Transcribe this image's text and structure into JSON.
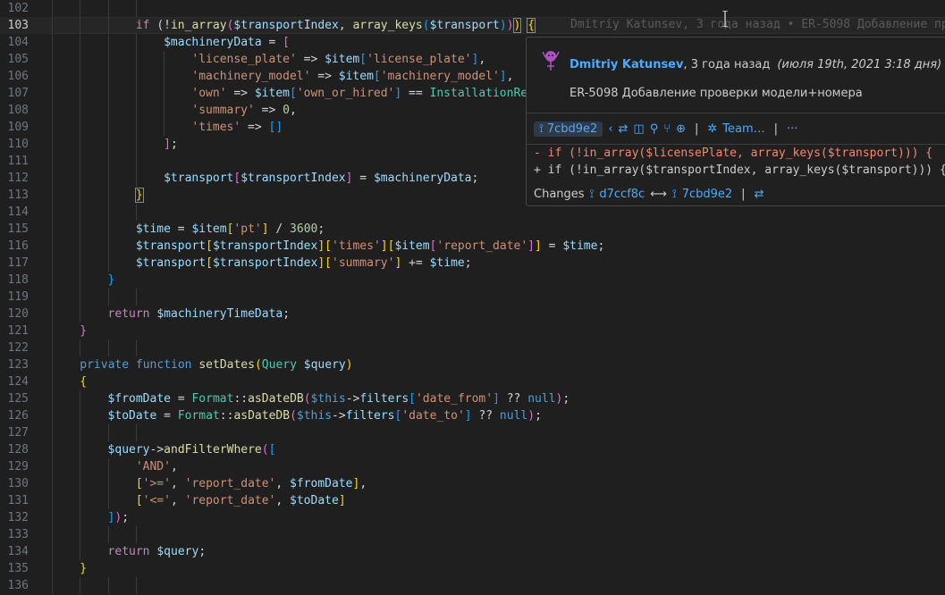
{
  "editor": {
    "lines": [
      {
        "n": "102",
        "segs": []
      },
      {
        "n": "103",
        "current": true,
        "segs": [
          [
            "kw",
            "if "
          ],
          [
            "op",
            "("
          ],
          [
            "op",
            "!"
          ],
          [
            "fn",
            "in_array"
          ],
          [
            "b2",
            "("
          ],
          [
            "var",
            "$transportIndex"
          ],
          [
            "op",
            ", "
          ],
          [
            "fn",
            "array_keys"
          ],
          [
            "b3",
            "("
          ],
          [
            "var",
            "$transport"
          ],
          [
            "b3",
            ")"
          ],
          [
            "b2",
            ")"
          ],
          [
            "b1bm",
            ")"
          ],
          [
            "op",
            " "
          ],
          [
            "b1bm",
            "{"
          ]
        ]
      },
      {
        "n": "104",
        "segs": [
          [
            "var",
            "$machineryData"
          ],
          [
            "op",
            " = "
          ],
          [
            "b2",
            "["
          ]
        ]
      },
      {
        "n": "105",
        "segs": [
          [
            "str",
            "'license_plate'"
          ],
          [
            "op",
            " => "
          ],
          [
            "var",
            "$item"
          ],
          [
            "b3",
            "["
          ],
          [
            "str",
            "'license_plate'"
          ],
          [
            "b3",
            "]"
          ],
          [
            "op",
            ","
          ]
        ]
      },
      {
        "n": "106",
        "segs": [
          [
            "str",
            "'machinery_model'"
          ],
          [
            "op",
            " => "
          ],
          [
            "var",
            "$item"
          ],
          [
            "b3",
            "["
          ],
          [
            "str",
            "'machinery_model'"
          ],
          [
            "b3",
            "]"
          ],
          [
            "op",
            ","
          ]
        ]
      },
      {
        "n": "107",
        "segs": [
          [
            "str",
            "'own'"
          ],
          [
            "op",
            " => "
          ],
          [
            "var",
            "$item"
          ],
          [
            "b3",
            "["
          ],
          [
            "str",
            "'own_or_hired'"
          ],
          [
            "b3",
            "]"
          ],
          [
            "op",
            " == "
          ],
          [
            "cls",
            "InstallationRep"
          ]
        ]
      },
      {
        "n": "108",
        "segs": [
          [
            "str",
            "'summary'"
          ],
          [
            "op",
            " => "
          ],
          [
            "num",
            "0"
          ],
          [
            "op",
            ","
          ]
        ]
      },
      {
        "n": "109",
        "segs": [
          [
            "str",
            "'times'"
          ],
          [
            "op",
            " => "
          ],
          [
            "b3",
            "[]"
          ]
        ]
      },
      {
        "n": "110",
        "segs": [
          [
            "b2",
            "]"
          ],
          [
            "op",
            ";"
          ]
        ]
      },
      {
        "n": "111",
        "segs": []
      },
      {
        "n": "112",
        "segs": [
          [
            "var",
            "$transport"
          ],
          [
            "b2",
            "["
          ],
          [
            "var",
            "$transportIndex"
          ],
          [
            "b2",
            "]"
          ],
          [
            "op",
            " = "
          ],
          [
            "var",
            "$machineryData"
          ],
          [
            "op",
            ";"
          ]
        ]
      },
      {
        "n": "113",
        "segs": [
          [
            "b1bm",
            "}"
          ]
        ]
      },
      {
        "n": "114",
        "segs": []
      },
      {
        "n": "115",
        "segs": [
          [
            "var",
            "$time"
          ],
          [
            "op",
            " = "
          ],
          [
            "var",
            "$item"
          ],
          [
            "b1",
            "["
          ],
          [
            "str",
            "'pt'"
          ],
          [
            "b1",
            "]"
          ],
          [
            "op",
            " / "
          ],
          [
            "num",
            "3600"
          ],
          [
            "op",
            ";"
          ]
        ]
      },
      {
        "n": "116",
        "segs": [
          [
            "var",
            "$transport"
          ],
          [
            "b1",
            "["
          ],
          [
            "var",
            "$transportIndex"
          ],
          [
            "b1",
            "]"
          ],
          [
            "b1",
            "["
          ],
          [
            "str",
            "'times'"
          ],
          [
            "b1",
            "]"
          ],
          [
            "b1",
            "["
          ],
          [
            "var",
            "$item"
          ],
          [
            "b2",
            "["
          ],
          [
            "str",
            "'report_date'"
          ],
          [
            "b2",
            "]"
          ],
          [
            "b1",
            "]"
          ],
          [
            "op",
            " = "
          ],
          [
            "var",
            "$time"
          ],
          [
            "op",
            ";"
          ]
        ]
      },
      {
        "n": "117",
        "segs": [
          [
            "var",
            "$transport"
          ],
          [
            "b1",
            "["
          ],
          [
            "var",
            "$transportIndex"
          ],
          [
            "b1",
            "]"
          ],
          [
            "b1",
            "["
          ],
          [
            "str",
            "'summary'"
          ],
          [
            "b1",
            "]"
          ],
          [
            "op",
            " += "
          ],
          [
            "var",
            "$time"
          ],
          [
            "op",
            ";"
          ]
        ]
      },
      {
        "n": "118",
        "segs": [
          [
            "b3",
            "}"
          ]
        ]
      },
      {
        "n": "119",
        "segs": []
      },
      {
        "n": "120",
        "segs": [
          [
            "kw",
            "return "
          ],
          [
            "var",
            "$machineryTimeData"
          ],
          [
            "op",
            ";"
          ]
        ]
      },
      {
        "n": "121",
        "segs": [
          [
            "b2",
            "}"
          ]
        ]
      },
      {
        "n": "122",
        "segs": []
      },
      {
        "n": "123",
        "segs": [
          [
            "cons",
            "private "
          ],
          [
            "cons",
            "function "
          ],
          [
            "fn",
            "setDates"
          ],
          [
            "b1",
            "("
          ],
          [
            "cls",
            "Query "
          ],
          [
            "var",
            "$query"
          ],
          [
            "b1",
            ")"
          ]
        ]
      },
      {
        "n": "124",
        "segs": [
          [
            "b1",
            "{"
          ]
        ]
      },
      {
        "n": "125",
        "segs": [
          [
            "var",
            "$fromDate"
          ],
          [
            "op",
            " = "
          ],
          [
            "cls",
            "Format"
          ],
          [
            "op",
            "::"
          ],
          [
            "fn",
            "asDateDB"
          ],
          [
            "b2",
            "("
          ],
          [
            "cons",
            "$this"
          ],
          [
            "op",
            "->"
          ],
          [
            "var",
            "filters"
          ],
          [
            "b3",
            "["
          ],
          [
            "str",
            "'date_from'"
          ],
          [
            "b3",
            "]"
          ],
          [
            "op",
            " ?? "
          ],
          [
            "cons",
            "null"
          ],
          [
            "b2",
            ")"
          ],
          [
            "op",
            ";"
          ]
        ]
      },
      {
        "n": "126",
        "segs": [
          [
            "var",
            "$toDate"
          ],
          [
            "op",
            " = "
          ],
          [
            "cls",
            "Format"
          ],
          [
            "op",
            "::"
          ],
          [
            "fn",
            "asDateDB"
          ],
          [
            "b2",
            "("
          ],
          [
            "cons",
            "$this"
          ],
          [
            "op",
            "->"
          ],
          [
            "var",
            "filters"
          ],
          [
            "b3",
            "["
          ],
          [
            "str",
            "'date_to'"
          ],
          [
            "b3",
            "]"
          ],
          [
            "op",
            " ?? "
          ],
          [
            "cons",
            "null"
          ],
          [
            "b2",
            ")"
          ],
          [
            "op",
            ";"
          ]
        ]
      },
      {
        "n": "127",
        "segs": []
      },
      {
        "n": "128",
        "segs": [
          [
            "var",
            "$query"
          ],
          [
            "op",
            "->"
          ],
          [
            "fn",
            "andFilterWhere"
          ],
          [
            "b2",
            "("
          ],
          [
            "b3",
            "["
          ]
        ]
      },
      {
        "n": "129",
        "segs": [
          [
            "str",
            "'AND'"
          ],
          [
            "op",
            ","
          ]
        ]
      },
      {
        "n": "130",
        "segs": [
          [
            "b1",
            "["
          ],
          [
            "str",
            "'>='"
          ],
          [
            "op",
            ", "
          ],
          [
            "str",
            "'report_date'"
          ],
          [
            "op",
            ", "
          ],
          [
            "var",
            "$fromDate"
          ],
          [
            "b1",
            "]"
          ],
          [
            "op",
            ","
          ]
        ]
      },
      {
        "n": "131",
        "segs": [
          [
            "b1",
            "["
          ],
          [
            "str",
            "'<='"
          ],
          [
            "op",
            ", "
          ],
          [
            "str",
            "'report_date'"
          ],
          [
            "op",
            ", "
          ],
          [
            "var",
            "$toDate"
          ],
          [
            "b1",
            "]"
          ]
        ]
      },
      {
        "n": "132",
        "segs": [
          [
            "b3",
            "]"
          ],
          [
            "b2",
            ")"
          ],
          [
            "op",
            ";"
          ]
        ]
      },
      {
        "n": "133",
        "segs": []
      },
      {
        "n": "134",
        "segs": [
          [
            "kw",
            "return "
          ],
          [
            "var",
            "$query"
          ],
          [
            "op",
            ";"
          ]
        ]
      },
      {
        "n": "135",
        "segs": [
          [
            "b1",
            "}"
          ]
        ]
      },
      {
        "n": "136",
        "segs": []
      }
    ],
    "inline_blame": "Dmitriy Katunsev, 3 года назад • ER-5098 Добавление пр"
  },
  "hover": {
    "author": "Dmitriy Katunsev",
    "relative": ", 3 года назад",
    "date": "(июля 19th, 2021 3:18 дня)",
    "message": "ER-5098 Добавление проверки модели+номера",
    "sha": "7cbd9e2",
    "team_label": "Team…",
    "more": "···",
    "diff_removed": "- if (!in_array($licensePlate, array_keys($transport))) {",
    "diff_added": "+ if (!in_array($transportIndex, array_keys($transport))) {",
    "changes_label": "Changes",
    "from_sha": "d7ccf8c",
    "arrow": "⟷",
    "to_sha": "7cbd9e2"
  },
  "colors": {
    "background": "#1f1f1f",
    "hover_background": "#202020",
    "link": "#4daafc",
    "removed": "#f48771",
    "added": "#cccccc"
  }
}
